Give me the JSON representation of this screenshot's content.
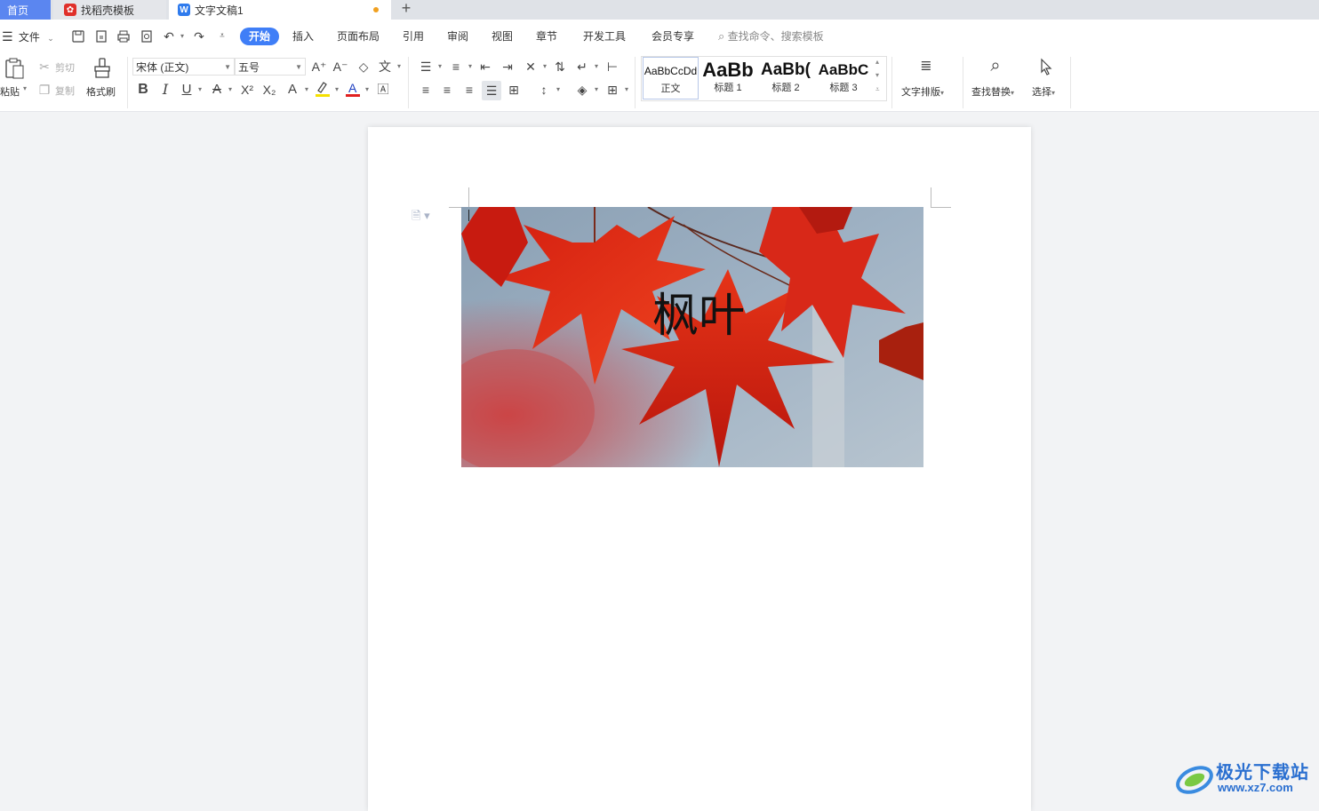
{
  "tabs": {
    "home": "首页",
    "template": "找稻壳模板",
    "document": "文字文稿1",
    "new_tab": "+"
  },
  "menu": {
    "file": "文件",
    "tabs": [
      "开始",
      "插入",
      "页面布局",
      "引用",
      "审阅",
      "视图",
      "章节",
      "开发工具",
      "会员专享"
    ],
    "active_tab": "开始",
    "search_placeholder": "查找命令、搜索模板"
  },
  "ribbon": {
    "paste": "粘贴",
    "cut": "剪切",
    "copy": "复制",
    "format_painter": "格式刷",
    "font_name": "宋体 (正文)",
    "font_size": "五号",
    "styles": [
      {
        "sample": "AaBbCcDd",
        "name": "正文"
      },
      {
        "sample": "AaBb",
        "name": "标题 1"
      },
      {
        "sample": "AaBb(",
        "name": "标题 2"
      },
      {
        "sample": "AaBbC",
        "name": "标题 3"
      }
    ],
    "text_layout": "文字排版",
    "find_replace": "查找替换",
    "select": "选择"
  },
  "document": {
    "image_caption": "枫叶"
  },
  "watermark": {
    "brand": "极光下载站",
    "url": "www.xz7.com"
  },
  "colors": {
    "accent": "#3f7ef7",
    "home_tab": "#5b86f0",
    "unsaved_dot": "#f0a020",
    "highlight": "#f5e000",
    "font_color_red": "#e02020"
  }
}
